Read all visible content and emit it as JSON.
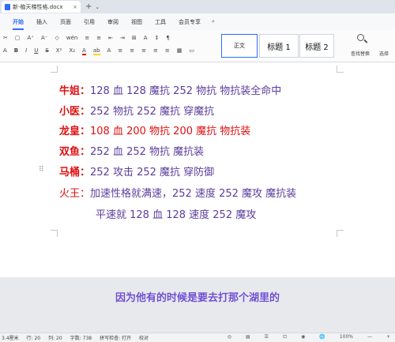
{
  "window": {
    "tab_title": "新-植天梯性格.docx",
    "close": "×",
    "new_tab": "+",
    "tab_menu": "⌄"
  },
  "menu": {
    "items": [
      "开始",
      "插入",
      "页面",
      "引用",
      "审阅",
      "视图",
      "工具",
      "会员专享"
    ]
  },
  "toolbar": {
    "row1": [
      "✂",
      "▢",
      "A⁺",
      "A⁻",
      "◇",
      "wén",
      "≡",
      "≡",
      "⇤",
      "⇥",
      "⊞",
      "A",
      "↕",
      "¶"
    ],
    "row2": [
      "A",
      "B",
      "I",
      "U",
      "S",
      "X²",
      "X₂",
      "A",
      "ab",
      "A",
      "≡",
      "≡",
      "≡",
      "≡",
      "≡",
      "▦",
      "▭"
    ],
    "styles": [
      "正文",
      "标题 1",
      "标题 2"
    ],
    "find_replace": "查找替换",
    "select": "选择"
  },
  "document": {
    "lines": [
      {
        "label": "牛姐：",
        "rest": "128 血  128 魔抗 252 物抗     物抗装全命中"
      },
      {
        "label": "小医：",
        "rest": "252 物抗 252 魔抗    穿魔抗"
      },
      {
        "label": "龙皇：",
        "rest": "108 血  200 物抗 200 魔抗     物抗装"
      },
      {
        "label": "双鱼：",
        "rest": "252 血 252 物抗    魔抗装"
      },
      {
        "label": "马桶：",
        "rest": "252 攻击 252 魔抗    穿防御"
      },
      {
        "label": "火王：",
        "rest": "加速性格就满速，252 速度 252 魔攻  魔抗装"
      },
      {
        "label": "",
        "rest": "平速就 128 血 128 速度 252 魔攻"
      }
    ],
    "paragraph_handle": "⠿"
  },
  "subtitle": "因为他有的时候是要去打那个湖里的",
  "status": {
    "items": [
      "3.4厘米",
      "行: 20",
      "列: 20",
      "字数: 738",
      "拼写检查: 打开",
      "校对"
    ],
    "right_items": [
      "◎",
      "▤",
      "☰",
      "⊡",
      "◉",
      "🌐",
      "100%",
      "—",
      "+"
    ]
  }
}
